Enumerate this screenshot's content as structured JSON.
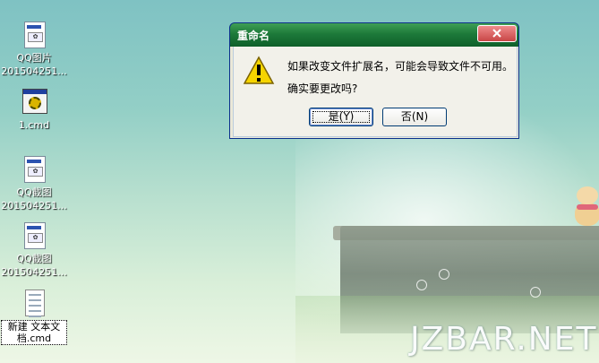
{
  "desktop": {
    "icons": [
      {
        "label_line1": "QQ图片",
        "label_line2": "201504251...",
        "icon": "image-file-icon"
      },
      {
        "label_line1": "1.cmd",
        "label_line2": "",
        "icon": "cmd-file-icon"
      },
      {
        "label_line1": "QQ截图",
        "label_line2": "201504251...",
        "icon": "image-file-icon"
      },
      {
        "label_line1": "QQ截图",
        "label_line2": "201504251...",
        "icon": "image-file-icon"
      },
      {
        "label_line1": "新建 文本文",
        "label_line2": "档.cmd",
        "icon": "text-file-icon"
      }
    ]
  },
  "watermark": "JZBAR.NET",
  "dialog": {
    "title": "重命名",
    "message_line1": "如果改变文件扩展名，可能会导致文件不可用。",
    "message_line2": "确实要更改吗?",
    "yes_label": "是(Y)",
    "no_label": "否(N)",
    "icon": "warning-icon",
    "title_color": "#1d7a3a"
  }
}
